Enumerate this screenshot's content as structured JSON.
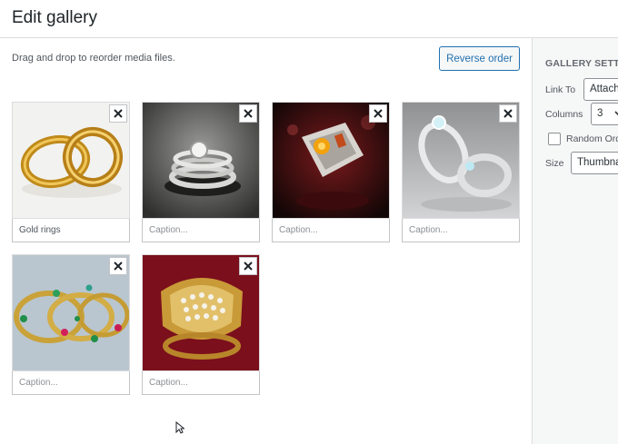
{
  "header": {
    "title": "Edit gallery"
  },
  "main": {
    "instructions": "Drag and drop to reorder media files.",
    "reverse_label": "Reverse order",
    "items": [
      {
        "caption": "Gold rings",
        "image": "gold-wedding-rings"
      },
      {
        "caption": "Caption...",
        "image": "silver-ring-stack"
      },
      {
        "caption": "Caption...",
        "image": "ring-on-red-background"
      },
      {
        "caption": "Caption...",
        "image": "silver-diamond-rings"
      },
      {
        "caption": "Caption...",
        "image": "gemstone-bangles"
      },
      {
        "caption": "Caption...",
        "image": "gold-diamond-ring"
      }
    ]
  },
  "sidebar": {
    "heading": "GALLERY SETTINGS",
    "link_to_label": "Link To",
    "link_to_value": "Attachment",
    "columns_label": "Columns",
    "columns_value": "3",
    "random_label": "Random Order",
    "size_label": "Size",
    "size_value": "Thumbnail"
  }
}
